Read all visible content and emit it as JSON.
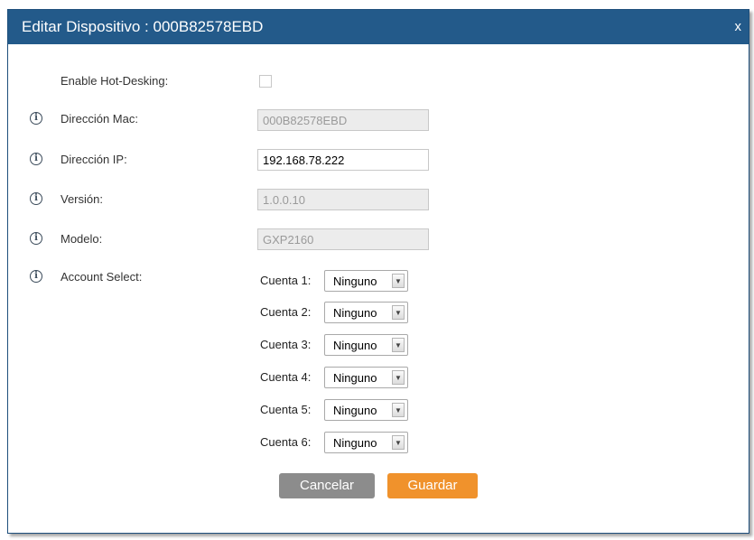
{
  "dialog": {
    "title": "Editar Dispositivo : 000B82578EBD",
    "close_label": "x"
  },
  "form": {
    "hot_desking": {
      "label": "Enable Hot-Desking:",
      "checked": false
    },
    "mac": {
      "label": "Dirección Mac:",
      "value": "000B82578EBD",
      "disabled": true
    },
    "ip": {
      "label": "Dirección IP:",
      "value": "192.168.78.222",
      "disabled": false
    },
    "version": {
      "label": "Versión:",
      "value": "1.0.0.10",
      "disabled": true
    },
    "model": {
      "label": "Modelo:",
      "value": "GXP2160",
      "disabled": true
    },
    "account_select": {
      "label": "Account Select:"
    }
  },
  "accounts": [
    {
      "label": "Cuenta 1:",
      "value": "Ninguno"
    },
    {
      "label": "Cuenta 2:",
      "value": "Ninguno"
    },
    {
      "label": "Cuenta 3:",
      "value": "Ninguno"
    },
    {
      "label": "Cuenta 4:",
      "value": "Ninguno"
    },
    {
      "label": "Cuenta 5:",
      "value": "Ninguno"
    },
    {
      "label": "Cuenta 6:",
      "value": "Ninguno"
    }
  ],
  "buttons": {
    "cancel_label": "Cancelar",
    "save_label": "Guardar"
  },
  "colors": {
    "titlebar": "#235a8a",
    "cancel": "#8c8c8c",
    "save": "#f0922c"
  },
  "icons": {
    "info": "info-circle-icon",
    "dropdown": "chevron-down-icon"
  }
}
